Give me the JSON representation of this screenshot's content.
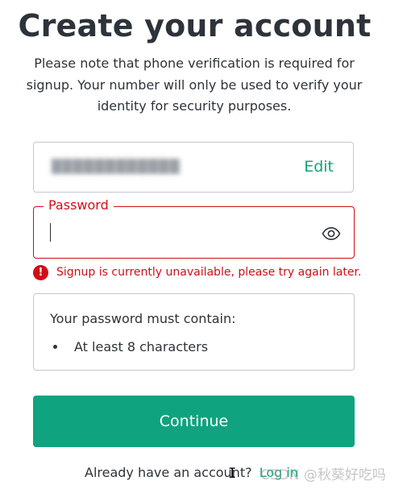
{
  "page": {
    "title": "Create your account",
    "subtitle": "Please note that phone verification is required for signup. Your number will only be used to verify your identity for security purposes."
  },
  "email": {
    "value": "████████████",
    "redacted": true,
    "edit_label": "Edit"
  },
  "password": {
    "label": "Password",
    "value": "",
    "toggle_icon": "eye-icon",
    "error": "Signup is currently unavailable, please try again later.",
    "error_icon": "!"
  },
  "requirements": {
    "heading": "Your password must contain:",
    "items": [
      "At least 8 characters"
    ]
  },
  "actions": {
    "continue_label": "Continue"
  },
  "footer": {
    "prompt": "Already have an account?",
    "login_label": "Log in"
  },
  "watermark": "CSDN @秋葵好吃吗",
  "colors": {
    "accent": "#10a37f",
    "error": "#d00e17",
    "border": "#c2c8d0",
    "text": "#2d333a"
  }
}
